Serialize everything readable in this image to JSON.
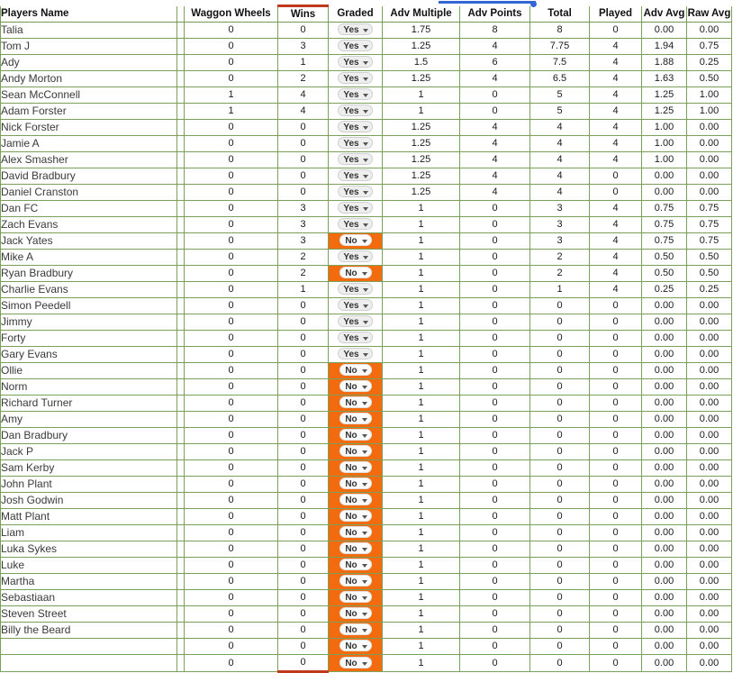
{
  "sheet": {
    "drag_indicator": {
      "visible": true,
      "color": "#3367d6"
    }
  },
  "columns": [
    {
      "key": "name",
      "label": "Players Name"
    },
    {
      "key": "gap",
      "label": ""
    },
    {
      "key": "ww",
      "label": "Waggon Wheels"
    },
    {
      "key": "wins",
      "label": "Wins"
    },
    {
      "key": "graded",
      "label": "Graded"
    },
    {
      "key": "advm",
      "label": "Adv Multiple"
    },
    {
      "key": "advp",
      "label": "Adv Points"
    },
    {
      "key": "total",
      "label": "Total"
    },
    {
      "key": "played",
      "label": "Played"
    },
    {
      "key": "advavg",
      "label": "Adv Avg"
    },
    {
      "key": "rawavg",
      "label": "Raw Avg"
    }
  ],
  "colors": {
    "grid_line": "#7ba05b",
    "wins_fill": "#b6e2a1",
    "wins_border": "#c0391b",
    "highlight_yellow": "#ffff00",
    "graded_no_fill": "#f26b0f",
    "drag_blue": "#3367d6"
  },
  "graded_options": [
    "Yes",
    "No"
  ],
  "rows": [
    {
      "name": "Talia",
      "ww": "0",
      "ww_hi": false,
      "wins": "0",
      "graded": "Yes",
      "advm": "1.75",
      "advp": "8",
      "total": "8",
      "played": "0",
      "advavg": "0.00",
      "rawavg": "0.00"
    },
    {
      "name": "Tom J",
      "ww": "0",
      "ww_hi": false,
      "wins": "3",
      "graded": "Yes",
      "advm": "1.25",
      "advp": "4",
      "total": "7.75",
      "played": "4",
      "advavg": "1.94",
      "rawavg": "0.75"
    },
    {
      "name": "Ady",
      "ww": "0",
      "ww_hi": false,
      "wins": "1",
      "graded": "Yes",
      "advm": "1.5",
      "advp": "6",
      "total": "7.5",
      "played": "4",
      "advavg": "1.88",
      "rawavg": "0.25"
    },
    {
      "name": "Andy Morton",
      "ww": "0",
      "ww_hi": false,
      "wins": "2",
      "graded": "Yes",
      "advm": "1.25",
      "advp": "4",
      "total": "6.5",
      "played": "4",
      "advavg": "1.63",
      "rawavg": "0.50"
    },
    {
      "name": "Sean McConnell",
      "ww": "1",
      "ww_hi": true,
      "wins": "4",
      "graded": "Yes",
      "advm": "1",
      "advp": "0",
      "total": "5",
      "played": "4",
      "advavg": "1.25",
      "rawavg": "1.00"
    },
    {
      "name": "Adam Forster",
      "ww": "1",
      "ww_hi": true,
      "wins": "4",
      "graded": "Yes",
      "advm": "1",
      "advp": "0",
      "total": "5",
      "played": "4",
      "advavg": "1.25",
      "rawavg": "1.00"
    },
    {
      "name": "Nick Forster",
      "ww": "0",
      "ww_hi": false,
      "wins": "0",
      "graded": "Yes",
      "advm": "1.25",
      "advp": "4",
      "total": "4",
      "played": "4",
      "advavg": "1.00",
      "rawavg": "0.00"
    },
    {
      "name": "Jamie A",
      "ww": "0",
      "ww_hi": false,
      "wins": "0",
      "graded": "Yes",
      "advm": "1.25",
      "advp": "4",
      "total": "4",
      "played": "4",
      "advavg": "1.00",
      "rawavg": "0.00"
    },
    {
      "name": "Alex Smasher",
      "ww": "0",
      "ww_hi": false,
      "wins": "0",
      "graded": "Yes",
      "advm": "1.25",
      "advp": "4",
      "total": "4",
      "played": "4",
      "advavg": "1.00",
      "rawavg": "0.00"
    },
    {
      "name": "David Bradbury",
      "ww": "0",
      "ww_hi": false,
      "wins": "0",
      "graded": "Yes",
      "advm": "1.25",
      "advp": "4",
      "total": "4",
      "played": "0",
      "advavg": "0.00",
      "rawavg": "0.00"
    },
    {
      "name": "Daniel Cranston",
      "ww": "0",
      "ww_hi": false,
      "wins": "0",
      "graded": "Yes",
      "advm": "1.25",
      "advp": "4",
      "total": "4",
      "played": "0",
      "advavg": "0.00",
      "rawavg": "0.00"
    },
    {
      "name": "Dan FC",
      "ww": "0",
      "ww_hi": false,
      "wins": "3",
      "graded": "Yes",
      "advm": "1",
      "advp": "0",
      "total": "3",
      "played": "4",
      "advavg": "0.75",
      "rawavg": "0.75"
    },
    {
      "name": "Zach Evans",
      "ww": "0",
      "ww_hi": false,
      "wins": "3",
      "graded": "Yes",
      "advm": "1",
      "advp": "0",
      "total": "3",
      "played": "4",
      "advavg": "0.75",
      "rawavg": "0.75"
    },
    {
      "name": "Jack Yates",
      "ww": "0",
      "ww_hi": false,
      "wins": "3",
      "graded": "No",
      "advm": "1",
      "advp": "0",
      "total": "3",
      "played": "4",
      "advavg": "0.75",
      "rawavg": "0.75"
    },
    {
      "name": "Mike A",
      "ww": "0",
      "ww_hi": false,
      "wins": "2",
      "graded": "Yes",
      "advm": "1",
      "advp": "0",
      "total": "2",
      "played": "4",
      "advavg": "0.50",
      "rawavg": "0.50"
    },
    {
      "name": "Ryan Bradbury",
      "ww": "0",
      "ww_hi": false,
      "wins": "2",
      "graded": "No",
      "advm": "1",
      "advp": "0",
      "total": "2",
      "played": "4",
      "advavg": "0.50",
      "rawavg": "0.50"
    },
    {
      "name": "Charlie Evans",
      "ww": "0",
      "ww_hi": false,
      "wins": "1",
      "graded": "Yes",
      "advm": "1",
      "advp": "0",
      "total": "1",
      "played": "4",
      "advavg": "0.25",
      "rawavg": "0.25"
    },
    {
      "name": "Simon Peedell",
      "ww": "0",
      "ww_hi": false,
      "wins": "0",
      "graded": "Yes",
      "advm": "1",
      "advp": "0",
      "total": "0",
      "played": "0",
      "advavg": "0.00",
      "rawavg": "0.00"
    },
    {
      "name": "Jimmy",
      "ww": "0",
      "ww_hi": false,
      "wins": "0",
      "graded": "Yes",
      "advm": "1",
      "advp": "0",
      "total": "0",
      "played": "0",
      "advavg": "0.00",
      "rawavg": "0.00"
    },
    {
      "name": "Forty",
      "ww": "0",
      "ww_hi": false,
      "wins": "0",
      "graded": "Yes",
      "advm": "1",
      "advp": "0",
      "total": "0",
      "played": "0",
      "advavg": "0.00",
      "rawavg": "0.00"
    },
    {
      "name": "Gary Evans",
      "ww": "0",
      "ww_hi": false,
      "wins": "0",
      "graded": "Yes",
      "advm": "1",
      "advp": "0",
      "total": "0",
      "played": "0",
      "advavg": "0.00",
      "rawavg": "0.00"
    },
    {
      "name": "Ollie",
      "ww": "0",
      "ww_hi": false,
      "wins": "0",
      "graded": "No",
      "advm": "1",
      "advp": "0",
      "total": "0",
      "played": "0",
      "advavg": "0.00",
      "rawavg": "0.00"
    },
    {
      "name": "Norm",
      "ww": "0",
      "ww_hi": false,
      "wins": "0",
      "graded": "No",
      "advm": "1",
      "advp": "0",
      "total": "0",
      "played": "0",
      "advavg": "0.00",
      "rawavg": "0.00"
    },
    {
      "name": "Richard Turner",
      "ww": "0",
      "ww_hi": false,
      "wins": "0",
      "graded": "No",
      "advm": "1",
      "advp": "0",
      "total": "0",
      "played": "0",
      "advavg": "0.00",
      "rawavg": "0.00"
    },
    {
      "name": "Amy",
      "ww": "0",
      "ww_hi": false,
      "wins": "0",
      "graded": "No",
      "advm": "1",
      "advp": "0",
      "total": "0",
      "played": "0",
      "advavg": "0.00",
      "rawavg": "0.00"
    },
    {
      "name": "Dan Bradbury",
      "ww": "0",
      "ww_hi": false,
      "wins": "0",
      "graded": "No",
      "advm": "1",
      "advp": "0",
      "total": "0",
      "played": "0",
      "advavg": "0.00",
      "rawavg": "0.00"
    },
    {
      "name": "Jack P",
      "ww": "0",
      "ww_hi": false,
      "wins": "0",
      "graded": "No",
      "advm": "1",
      "advp": "0",
      "total": "0",
      "played": "0",
      "advavg": "0.00",
      "rawavg": "0.00"
    },
    {
      "name": "Sam Kerby",
      "ww": "0",
      "ww_hi": false,
      "wins": "0",
      "graded": "No",
      "advm": "1",
      "advp": "0",
      "total": "0",
      "played": "0",
      "advavg": "0.00",
      "rawavg": "0.00"
    },
    {
      "name": "John Plant",
      "ww": "0",
      "ww_hi": false,
      "wins": "0",
      "graded": "No",
      "advm": "1",
      "advp": "0",
      "total": "0",
      "played": "0",
      "advavg": "0.00",
      "rawavg": "0.00"
    },
    {
      "name": "Josh Godwin",
      "ww": "0",
      "ww_hi": false,
      "wins": "0",
      "graded": "No",
      "advm": "1",
      "advp": "0",
      "total": "0",
      "played": "0",
      "advavg": "0.00",
      "rawavg": "0.00"
    },
    {
      "name": "Matt Plant",
      "ww": "0",
      "ww_hi": false,
      "wins": "0",
      "graded": "No",
      "advm": "1",
      "advp": "0",
      "total": "0",
      "played": "0",
      "advavg": "0.00",
      "rawavg": "0.00"
    },
    {
      "name": "Liam",
      "ww": "0",
      "ww_hi": false,
      "wins": "0",
      "graded": "No",
      "advm": "1",
      "advp": "0",
      "total": "0",
      "played": "0",
      "advavg": "0.00",
      "rawavg": "0.00"
    },
    {
      "name": "Luka Sykes",
      "ww": "0",
      "ww_hi": false,
      "wins": "0",
      "graded": "No",
      "advm": "1",
      "advp": "0",
      "total": "0",
      "played": "0",
      "advavg": "0.00",
      "rawavg": "0.00"
    },
    {
      "name": "Luke",
      "ww": "0",
      "ww_hi": false,
      "wins": "0",
      "graded": "No",
      "advm": "1",
      "advp": "0",
      "total": "0",
      "played": "0",
      "advavg": "0.00",
      "rawavg": "0.00"
    },
    {
      "name": "Martha",
      "ww": "0",
      "ww_hi": false,
      "wins": "0",
      "graded": "No",
      "advm": "1",
      "advp": "0",
      "total": "0",
      "played": "0",
      "advavg": "0.00",
      "rawavg": "0.00"
    },
    {
      "name": "Sebastiaan",
      "ww": "0",
      "ww_hi": false,
      "wins": "0",
      "graded": "No",
      "advm": "1",
      "advp": "0",
      "total": "0",
      "played": "0",
      "advavg": "0.00",
      "rawavg": "0.00"
    },
    {
      "name": "Steven Street",
      "ww": "0",
      "ww_hi": false,
      "wins": "0",
      "graded": "No",
      "advm": "1",
      "advp": "0",
      "total": "0",
      "played": "0",
      "advavg": "0.00",
      "rawavg": "0.00"
    },
    {
      "name": "Billy the Beard",
      "ww": "0",
      "ww_hi": false,
      "wins": "0",
      "graded": "No",
      "advm": "1",
      "advp": "0",
      "total": "0",
      "played": "0",
      "advavg": "0.00",
      "rawavg": "0.00"
    },
    {
      "name": "",
      "ww": "0",
      "ww_hi": false,
      "wins": "0",
      "graded": "No",
      "advm": "1",
      "advp": "0",
      "total": "0",
      "played": "0",
      "advavg": "0.00",
      "rawavg": "0.00"
    },
    {
      "name": "",
      "ww": "0",
      "ww_hi": false,
      "wins": "0",
      "graded": "No",
      "advm": "1",
      "advp": "0",
      "total": "0",
      "played": "0",
      "advavg": "0.00",
      "rawavg": "0.00"
    }
  ]
}
